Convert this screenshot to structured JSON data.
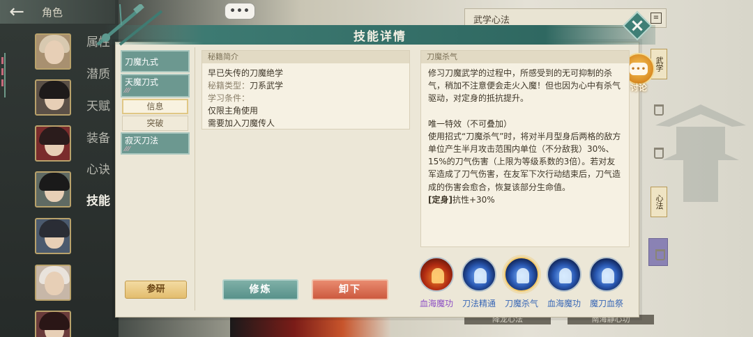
{
  "header": {
    "back_label": "角色"
  },
  "nav": {
    "items": [
      "属性",
      "潜质",
      "天赋",
      "装备",
      "心诀",
      "技能"
    ],
    "active": "技能"
  },
  "chat_top": {
    "label": "•••"
  },
  "right_panel": {
    "title": "武学心法",
    "tab_wuxue": "武学",
    "tab_xinfa": "心法",
    "bottom_labels": [
      "降龙心法",
      "南海静心功"
    ]
  },
  "dialog": {
    "title": "技能详情",
    "discuss_label": "讨论",
    "skill_list": [
      {
        "name": "刀魔九式",
        "feathers": ""
      },
      {
        "name": "天魔刀式",
        "feathers": "⁄⁄⁄"
      },
      {
        "name": "寂灭刀法",
        "feathers": "⁄⁄⁄"
      }
    ],
    "sub_tabs": [
      "信息",
      "突破"
    ],
    "research_label": "参研",
    "manual": {
      "head": "秘籍简介",
      "line1": "早已失传的刀魔绝学",
      "type_label": "秘籍类型：",
      "type_value": "刀系武学",
      "cond_label": "学习条件：",
      "cond1": "仅限主角使用",
      "cond2": "需要加入刀魔传人"
    },
    "train_label": "修炼",
    "unequip_label": "卸下",
    "desc": {
      "head": "刀魔杀气",
      "para1": "修习刀魔武学的过程中，所感受到的无可抑制的杀气，稍加不注意便会走火入魔！但也因为心中有杀气驱动，对定身的抵抗提升。",
      "unique_title": "唯一特效（不可叠加）",
      "para2": "使用招式“刀魔杀气”时，将对半月型身后两格的敌方单位产生半月攻击范围内单位（不分敌我）30%、15%的刀气伤害（上限为等级系数的3倍）。若对友军造成了刀气伤害，在友军下次行动结束后，刀气造成的伤害会愈合，恢复该部分生命值。",
      "stat_tag": "[定身]",
      "stat_value": "抗性+30%"
    },
    "skills": [
      {
        "label": "血海魔功",
        "style": "fire",
        "label_color": "purple",
        "selected": false
      },
      {
        "label": "刀法精通",
        "style": "blue",
        "label_color": "blue",
        "selected": false
      },
      {
        "label": "刀魔杀气",
        "style": "blue",
        "label_color": "blue",
        "selected": true
      },
      {
        "label": "血海魔功",
        "style": "blue",
        "label_color": "blue",
        "selected": false
      },
      {
        "label": "魔刀血祭",
        "style": "blue",
        "label_color": "blue",
        "selected": false
      }
    ]
  }
}
